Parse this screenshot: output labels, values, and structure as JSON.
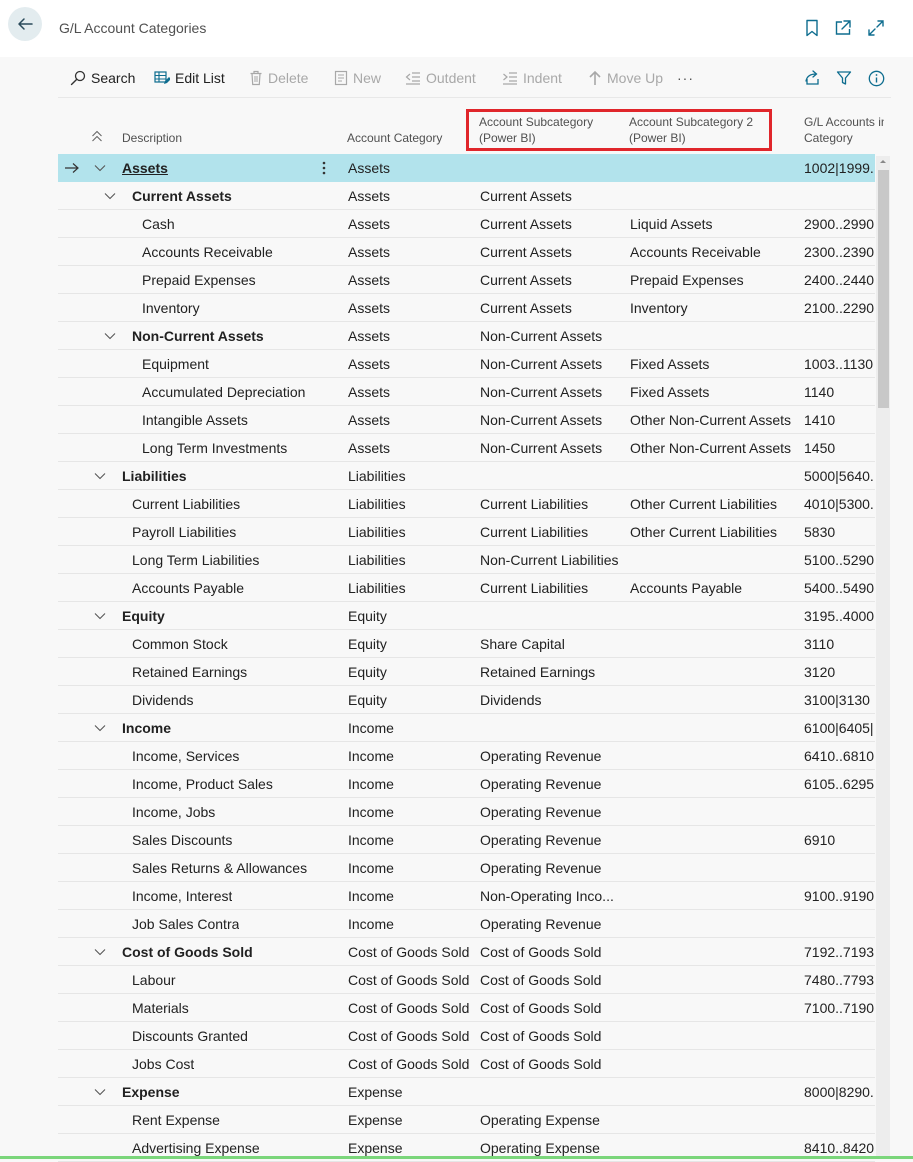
{
  "window": {
    "title": "G/L Account Categories"
  },
  "toolbar": {
    "search": "Search",
    "edit_list": "Edit List",
    "delete": "Delete",
    "new": "New",
    "outdent": "Outdent",
    "indent": "Indent",
    "move_up": "Move Up",
    "more": "···"
  },
  "columns": {
    "description": "Description",
    "account_category": "Account Category",
    "subcategory_1": "Account Subcategory (Power BI)",
    "subcategory_1_line1": "Account Subcategory",
    "subcategory_1_line2": "(Power BI)",
    "subcategory_2": "Account Subcategory 2 (Power BI)",
    "subcategory_2_line1": "Account Subcategory 2",
    "subcategory_2_line2": "(Power BI)",
    "gl_accounts": "G/L Accounts in Category",
    "gl_accounts_line1": "G/L Accounts in",
    "gl_accounts_line2": "Category"
  },
  "rows": [
    {
      "description": "Assets",
      "level": 0,
      "bold": true,
      "expandable": true,
      "selected": true,
      "category": "Assets",
      "subcategory": "",
      "subcategory2": "",
      "gl_accounts": "1002|1999..."
    },
    {
      "description": "Current Assets",
      "level": 1,
      "bold": true,
      "expandable": true,
      "category": "Assets",
      "subcategory": "Current Assets",
      "subcategory2": "",
      "gl_accounts": ""
    },
    {
      "description": "Cash",
      "level": 2,
      "category": "Assets",
      "subcategory": "Current Assets",
      "subcategory2": "Liquid Assets",
      "gl_accounts": "2900..2990"
    },
    {
      "description": "Accounts Receivable",
      "level": 2,
      "category": "Assets",
      "subcategory": "Current Assets",
      "subcategory2": "Accounts Receivable",
      "gl_accounts": "2300..2390|"
    },
    {
      "description": "Prepaid Expenses",
      "level": 2,
      "category": "Assets",
      "subcategory": "Current Assets",
      "subcategory2": "Prepaid Expenses",
      "gl_accounts": "2400..2440"
    },
    {
      "description": "Inventory",
      "level": 2,
      "category": "Assets",
      "subcategory": "Current Assets",
      "subcategory2": "Inventory",
      "gl_accounts": "2100..2290"
    },
    {
      "description": "Non-Current Assets",
      "level": 1,
      "bold": true,
      "expandable": true,
      "category": "Assets",
      "subcategory": "Non-Current Assets",
      "subcategory2": "",
      "gl_accounts": ""
    },
    {
      "description": "Equipment",
      "level": 2,
      "category": "Assets",
      "subcategory": "Non-Current Assets",
      "subcategory2": "Fixed Assets",
      "gl_accounts": "1003..1130|"
    },
    {
      "description": "Accumulated Depreciation",
      "level": 2,
      "category": "Assets",
      "subcategory": "Non-Current Assets",
      "subcategory2": "Fixed Assets",
      "gl_accounts": "1140"
    },
    {
      "description": "Intangible Assets",
      "level": 2,
      "category": "Assets",
      "subcategory": "Non-Current Assets",
      "subcategory2": "Other Non-Current Assets",
      "gl_accounts": "1410"
    },
    {
      "description": "Long Term Investments",
      "level": 2,
      "category": "Assets",
      "subcategory": "Non-Current Assets",
      "subcategory2": "Other Non-Current Assets",
      "gl_accounts": "1450"
    },
    {
      "description": "Liabilities",
      "level": 0,
      "bold": true,
      "expandable": true,
      "category": "Liabilities",
      "subcategory": "",
      "subcategory2": "",
      "gl_accounts": "5000|5640..."
    },
    {
      "description": "Current Liabilities",
      "level": 1,
      "category": "Liabilities",
      "subcategory": "Current Liabilities",
      "subcategory2": "Other Current Liabilities",
      "gl_accounts": "4010|5300..."
    },
    {
      "description": "Payroll Liabilities",
      "level": 1,
      "category": "Liabilities",
      "subcategory": "Current Liabilities",
      "subcategory2": "Other Current Liabilities",
      "gl_accounts": "5830"
    },
    {
      "description": "Long Term Liabilities",
      "level": 1,
      "category": "Liabilities",
      "subcategory": "Non-Current Liabilities",
      "subcategory2": "",
      "gl_accounts": "5100..5290"
    },
    {
      "description": "Accounts Payable",
      "level": 1,
      "category": "Liabilities",
      "subcategory": "Current Liabilities",
      "subcategory2": "Accounts Payable",
      "gl_accounts": "5400..5490"
    },
    {
      "description": "Equity",
      "level": 0,
      "bold": true,
      "expandable": true,
      "category": "Equity",
      "subcategory": "",
      "subcategory2": "",
      "gl_accounts": "3195..4000|"
    },
    {
      "description": "Common Stock",
      "level": 1,
      "category": "Equity",
      "subcategory": "Share Capital",
      "subcategory2": "",
      "gl_accounts": "3110"
    },
    {
      "description": "Retained Earnings",
      "level": 1,
      "category": "Equity",
      "subcategory": "Retained Earnings",
      "subcategory2": "",
      "gl_accounts": "3120"
    },
    {
      "description": "Dividends",
      "level": 1,
      "category": "Equity",
      "subcategory": "Dividends",
      "subcategory2": "",
      "gl_accounts": "3100|3130"
    },
    {
      "description": "Income",
      "level": 0,
      "bold": true,
      "expandable": true,
      "category": "Income",
      "subcategory": "",
      "subcategory2": "",
      "gl_accounts": "6100|6405|6"
    },
    {
      "description": "Income, Services",
      "level": 1,
      "category": "Income",
      "subcategory": "Operating Revenue",
      "subcategory2": "",
      "gl_accounts": "6410..6810"
    },
    {
      "description": "Income, Product Sales",
      "level": 1,
      "category": "Income",
      "subcategory": "Operating Revenue",
      "subcategory2": "",
      "gl_accounts": "6105..6295"
    },
    {
      "description": "Income, Jobs",
      "level": 1,
      "category": "Income",
      "subcategory": "Operating Revenue",
      "subcategory2": "",
      "gl_accounts": ""
    },
    {
      "description": "Sales Discounts",
      "level": 1,
      "category": "Income",
      "subcategory": "Operating Revenue",
      "subcategory2": "",
      "gl_accounts": "6910"
    },
    {
      "description": "Sales Returns & Allowances",
      "level": 1,
      "category": "Income",
      "subcategory": "Operating Revenue",
      "subcategory2": "",
      "gl_accounts": ""
    },
    {
      "description": "Income, Interest",
      "level": 1,
      "category": "Income",
      "subcategory": "Non-Operating Inco...",
      "subcategory2": "",
      "gl_accounts": "9100..9190"
    },
    {
      "description": "Job Sales Contra",
      "level": 1,
      "category": "Income",
      "subcategory": "Operating Revenue",
      "subcategory2": "",
      "gl_accounts": ""
    },
    {
      "description": "Cost of Goods Sold",
      "level": 0,
      "bold": true,
      "expandable": true,
      "category": "Cost of Goods Sold",
      "subcategory": "Cost of Goods Sold",
      "subcategory2": "",
      "gl_accounts": "7192..7193|"
    },
    {
      "description": "Labour",
      "level": 1,
      "category": "Cost of Goods Sold",
      "subcategory": "Cost of Goods Sold",
      "subcategory2": "",
      "gl_accounts": "7480..7793"
    },
    {
      "description": "Materials",
      "level": 1,
      "category": "Cost of Goods Sold",
      "subcategory": "Cost of Goods Sold",
      "subcategory2": "",
      "gl_accounts": "7100..7190|"
    },
    {
      "description": "Discounts Granted",
      "level": 1,
      "category": "Cost of Goods Sold",
      "subcategory": "Cost of Goods Sold",
      "subcategory2": "",
      "gl_accounts": ""
    },
    {
      "description": "Jobs Cost",
      "level": 1,
      "category": "Cost of Goods Sold",
      "subcategory": "Cost of Goods Sold",
      "subcategory2": "",
      "gl_accounts": ""
    },
    {
      "description": "Expense",
      "level": 0,
      "bold": true,
      "expandable": true,
      "category": "Expense",
      "subcategory": "",
      "subcategory2": "",
      "gl_accounts": "8000|8290..."
    },
    {
      "description": "Rent Expense",
      "level": 1,
      "category": "Expense",
      "subcategory": "Operating Expense",
      "subcategory2": "",
      "gl_accounts": ""
    },
    {
      "description": "Advertising Expense",
      "level": 1,
      "category": "Expense",
      "subcategory": "Operating Expense",
      "subcategory2": "",
      "gl_accounts": "8410..8420"
    }
  ],
  "colors": {
    "selected_row": "#b2e3ec",
    "highlight_box": "#e0262b",
    "back_button_bg": "#e3ecef",
    "accent": "#0e6d8f"
  }
}
